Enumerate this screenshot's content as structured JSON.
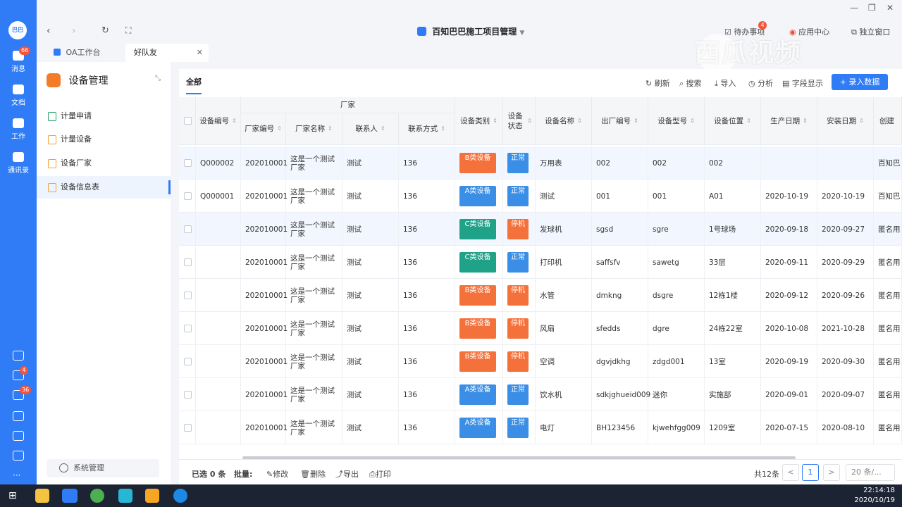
{
  "rail": {
    "logo": "巴巴",
    "items": [
      {
        "label": "消息",
        "badge": "66"
      },
      {
        "label": "文档",
        "badge": ""
      },
      {
        "label": "工作",
        "badge": ""
      },
      {
        "label": "通讯录",
        "badge": ""
      }
    ],
    "bottom_badges": {
      "todo": "4",
      "flow": "36"
    }
  },
  "topbar": {
    "app_title": "百知巴巴施工项目管理",
    "todo_label": "待办事项",
    "todo_badge": "4",
    "app_center": "应用中心",
    "standalone": "独立窗口"
  },
  "tabs": [
    {
      "label": "OA工作台"
    },
    {
      "label": "好队友"
    }
  ],
  "sidebar": {
    "title": "设备管理",
    "items": [
      {
        "label": "计量申请"
      },
      {
        "label": "计量设备"
      },
      {
        "label": "设备厂家"
      },
      {
        "label": "设备信息表"
      }
    ],
    "footer": "系统管理"
  },
  "toolbar": {
    "tab_all": "全部",
    "refresh": "刷新",
    "search": "搜索",
    "import": "导入",
    "analysis": "分析",
    "fields": "字段显示",
    "add": "+ 录入数据"
  },
  "table": {
    "group_header": "厂家",
    "headers": {
      "code": "设备编号",
      "vendor_code": "厂家编号",
      "vendor_name": "厂家名称",
      "contact": "联系人",
      "phone": "联系方式",
      "category": "设备类别",
      "status": "设备状态",
      "name": "设备名称",
      "serial": "出厂编号",
      "model": "设备型号",
      "location": "设备位置",
      "prod_date": "生产日期",
      "install_date": "安装日期",
      "creator": "创建"
    },
    "rows": [
      {
        "code": "Q000002",
        "vendor_code": "202010001",
        "vendor_name": "这是一个测试厂家",
        "contact": "测试",
        "phone": "136",
        "category": "B类设备",
        "status": "正常",
        "name": "万用表",
        "serial": "002",
        "model": "002",
        "location": "002",
        "prod_date": "",
        "install_date": "",
        "creator": "百知巴"
      },
      {
        "code": "Q000001",
        "vendor_code": "202010001",
        "vendor_name": "这是一个测试厂家",
        "contact": "测试",
        "phone": "136",
        "category": "A类设备",
        "status": "正常",
        "name": "测试",
        "serial": "001",
        "model": "001",
        "location": "A01",
        "prod_date": "2020-10-19",
        "install_date": "2020-10-19",
        "creator": "百知巴"
      },
      {
        "code": "",
        "vendor_code": "202010001",
        "vendor_name": "这是一个测试厂家",
        "contact": "测试",
        "phone": "136",
        "category": "C类设备",
        "status": "停机",
        "name": "发球机",
        "serial": "sgsd",
        "model": "sgre",
        "location": "1号球场",
        "prod_date": "2020-09-18",
        "install_date": "2020-09-27",
        "creator": "匿名用"
      },
      {
        "code": "",
        "vendor_code": "202010001",
        "vendor_name": "这是一个测试厂家",
        "contact": "测试",
        "phone": "136",
        "category": "C类设备",
        "status": "正常",
        "name": "打印机",
        "serial": "saffsfv",
        "model": "sawetg",
        "location": "33层",
        "prod_date": "2020-09-11",
        "install_date": "2020-09-29",
        "creator": "匿名用"
      },
      {
        "code": "",
        "vendor_code": "202010001",
        "vendor_name": "这是一个测试厂家",
        "contact": "测试",
        "phone": "136",
        "category": "B类设备",
        "status": "停机",
        "name": "水管",
        "serial": "dmkng",
        "model": "dsgre",
        "location": "12栋1楼",
        "prod_date": "2020-09-12",
        "install_date": "2020-09-26",
        "creator": "匿名用"
      },
      {
        "code": "",
        "vendor_code": "202010001",
        "vendor_name": "这是一个测试厂家",
        "contact": "测试",
        "phone": "136",
        "category": "B类设备",
        "status": "停机",
        "name": "风扇",
        "serial": "sfedds",
        "model": "dgre",
        "location": "24栋22室",
        "prod_date": "2020-10-08",
        "install_date": "2021-10-28",
        "creator": "匿名用"
      },
      {
        "code": "",
        "vendor_code": "202010001",
        "vendor_name": "这是一个测试厂家",
        "contact": "测试",
        "phone": "136",
        "category": "B类设备",
        "status": "停机",
        "name": "空调",
        "serial": "dgvjdkhg",
        "model": "zdgd001",
        "location": "13室",
        "prod_date": "2020-09-19",
        "install_date": "2020-09-30",
        "creator": "匿名用"
      },
      {
        "code": "",
        "vendor_code": "202010001",
        "vendor_name": "这是一个测试厂家",
        "contact": "测试",
        "phone": "136",
        "category": "A类设备",
        "status": "正常",
        "name": "饮水机",
        "serial": "sdkjghueid009",
        "model": "迷你",
        "location": "实施部",
        "prod_date": "2020-09-01",
        "install_date": "2020-09-07",
        "creator": "匿名用"
      },
      {
        "code": "",
        "vendor_code": "202010001",
        "vendor_name": "这是一个测试厂家",
        "contact": "测试",
        "phone": "136",
        "category": "A类设备",
        "status": "正常",
        "name": "电灯",
        "serial": "BH123456",
        "model": "kjwehfgg009",
        "location": "1209室",
        "prod_date": "2020-07-15",
        "install_date": "2020-08-10",
        "creator": "匿名用"
      }
    ]
  },
  "footer": {
    "selected": "已选 0 条",
    "batch": "批量:",
    "edit": "修改",
    "delete": "删除",
    "export": "导出",
    "print": "打印",
    "total": "共12条",
    "prev": "<",
    "page": "1",
    "next": ">",
    "page_size": "20 条/..."
  },
  "colors": {
    "primary": "#2f7cf6",
    "cat_A": "#3a8ee6",
    "cat_B": "#f5713b",
    "cat_C": "#1fa287",
    "status_ok": "#3a8ee6",
    "status_stop": "#f5713b"
  },
  "watermark": "西瓜视频",
  "taskbar": {
    "time": "22:14:18",
    "date": "2020/10/19"
  }
}
